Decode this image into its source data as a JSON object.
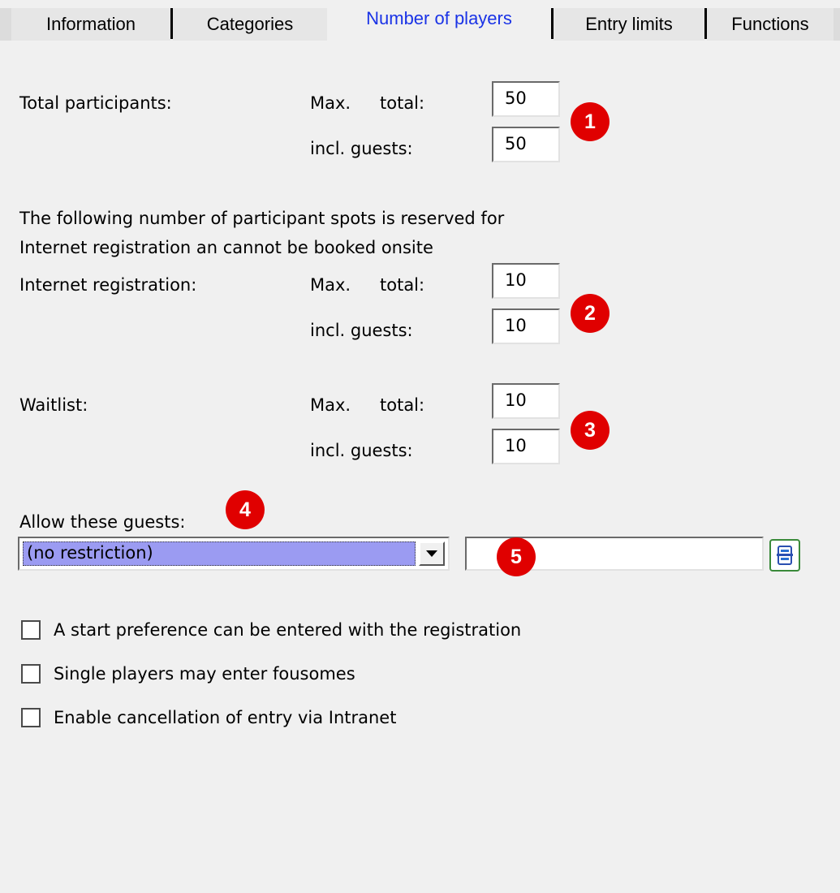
{
  "tabs": [
    {
      "label": "Information",
      "active": false
    },
    {
      "label": "Categories",
      "active": false
    },
    {
      "label": "Number of players",
      "active": true
    },
    {
      "label": "Entry limits",
      "active": false
    },
    {
      "label": "Functions",
      "active": false
    }
  ],
  "total_participants": {
    "label": "Total participants:",
    "max_label": "Max.",
    "total_label": "total:",
    "total_value": "50",
    "guests_label": "incl. guests:",
    "guests_value": "50",
    "badge": "1"
  },
  "reserved_note": {
    "line1": "The following number of participant spots is reserved for",
    "line2": "Internet registration an cannot be booked onsite"
  },
  "internet_registration": {
    "label": "Internet registration:",
    "max_label": "Max.",
    "total_label": "total:",
    "total_value": "10",
    "guests_label": "incl. guests:",
    "guests_value": "10",
    "badge": "2"
  },
  "waitlist": {
    "label": "Waitlist:",
    "max_label": "Max.",
    "total_label": "total:",
    "total_value": "10",
    "guests_label": "incl. guests:",
    "guests_value": "10",
    "badge": "3"
  },
  "guests": {
    "label": "Allow these guests:",
    "badge": "4",
    "selected": "(no restriction)",
    "text_value": "",
    "text_badge": "5",
    "lookup_icon": "list-lookup-icon"
  },
  "options": [
    {
      "label": "A start preference can be entered with the registration",
      "checked": false
    },
    {
      "label": "Single players may enter fousomes",
      "checked": false
    },
    {
      "label": "Enable cancellation of entry via Intranet",
      "checked": false
    }
  ],
  "colors": {
    "active_tab_text": "#1a33e6",
    "badge": "#e00000",
    "selection_highlight": "#9b9bf2",
    "lookup_border": "#3a8a3a"
  }
}
